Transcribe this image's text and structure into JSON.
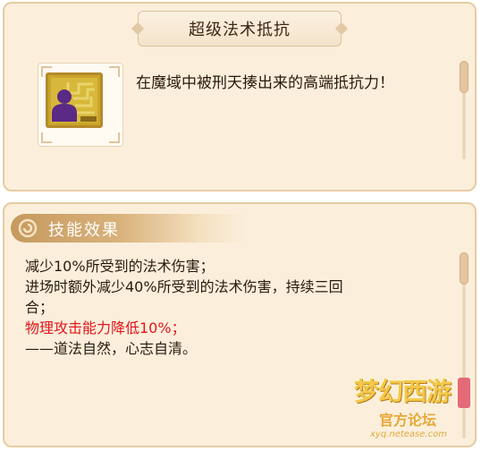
{
  "skill": {
    "name": "超级法术抵抗",
    "description": "在魔域中被刑天揍出来的高端抵抗力！",
    "icon": "skill-rune-icon"
  },
  "effects_section": {
    "header": "技能效果",
    "lines": [
      "减少10%所受到的法术伤害；",
      "进场时额外减少40%所受到的法术伤害，持续三回",
      "合；",
      "物理攻击能力降低10%；",
      "——道法自然，心志自清。"
    ]
  },
  "watermark": {
    "logo": "梦幻西游",
    "subtitle": "官方论坛",
    "url": "xyq.netease.com"
  },
  "colors": {
    "panel_bg": "#fbefdc",
    "panel_border": "#e7cba2",
    "header_bar": "#c69a5e",
    "warning_text": "#e3141b"
  }
}
